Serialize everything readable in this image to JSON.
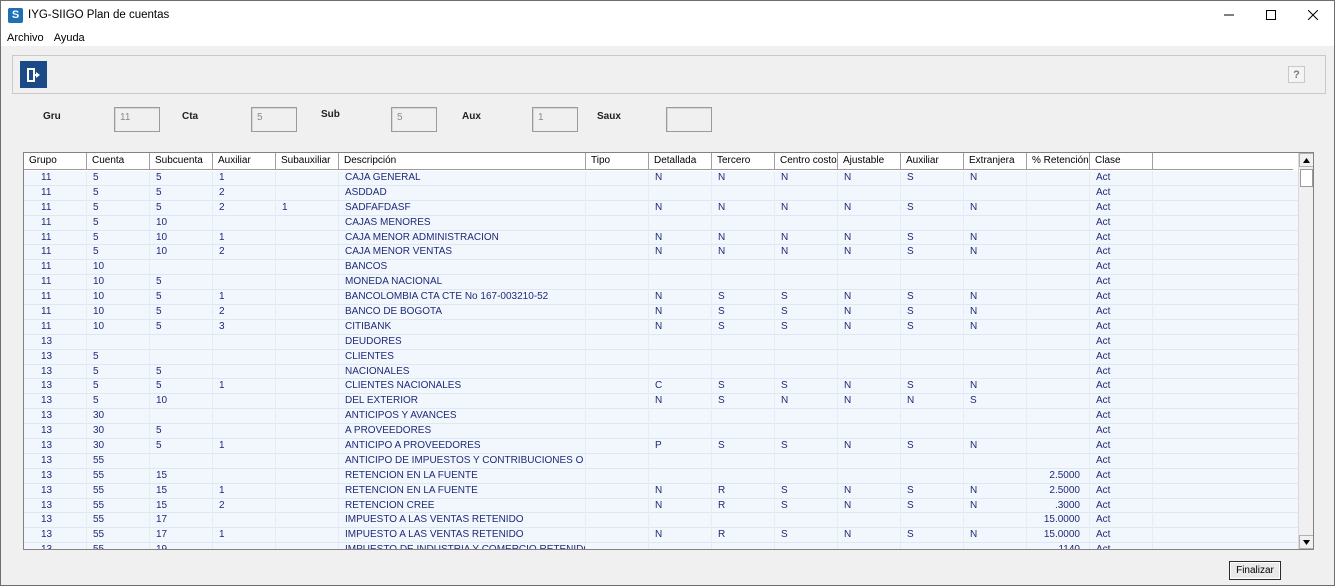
{
  "window": {
    "title": "IYG-SIIGO Plan de cuentas",
    "app_icon_letter": "S"
  },
  "menu": [
    "Archivo",
    "Ayuda"
  ],
  "toolbar": {
    "help_label": "?"
  },
  "filters": {
    "gru": {
      "label": "Gru",
      "value": "11"
    },
    "cta": {
      "label": "Cta",
      "value": "5"
    },
    "sub": {
      "label": "Sub",
      "value": "5"
    },
    "aux": {
      "label": "Aux",
      "value": "1"
    },
    "saux": {
      "label": "Saux",
      "value": ""
    }
  },
  "grid": {
    "columns": [
      "Grupo",
      "Cuenta",
      "Subcuenta",
      "Auxiliar",
      "Subauxiliar",
      "Descripción",
      "Tipo",
      "Detallada",
      "Tercero",
      "Centro costo",
      "Ajustable",
      "Auxiliar",
      "Extranjera",
      "% Retención",
      "Clase"
    ],
    "rows": [
      [
        "11",
        "5",
        "5",
        "1",
        "",
        "CAJA GENERAL",
        "",
        "N",
        "N",
        "N",
        "N",
        "S",
        "N",
        "",
        "Act"
      ],
      [
        "11",
        "5",
        "5",
        "2",
        "",
        "ASDDAD",
        "",
        "",
        "",
        "",
        "",
        "",
        "",
        "",
        "Act"
      ],
      [
        "11",
        "5",
        "5",
        "2",
        "1",
        "SADFAFDASF",
        "",
        "N",
        "N",
        "N",
        "N",
        "S",
        "N",
        "",
        "Act"
      ],
      [
        "11",
        "5",
        "10",
        "",
        "",
        "CAJAS MENORES",
        "",
        "",
        "",
        "",
        "",
        "",
        "",
        "",
        "Act"
      ],
      [
        "11",
        "5",
        "10",
        "1",
        "",
        "CAJA MENOR ADMINISTRACION",
        "",
        "N",
        "N",
        "N",
        "N",
        "S",
        "N",
        "",
        "Act"
      ],
      [
        "11",
        "5",
        "10",
        "2",
        "",
        "CAJA MENOR VENTAS",
        "",
        "N",
        "N",
        "N",
        "N",
        "S",
        "N",
        "",
        "Act"
      ],
      [
        "11",
        "10",
        "",
        "",
        "",
        "BANCOS",
        "",
        "",
        "",
        "",
        "",
        "",
        "",
        "",
        "Act"
      ],
      [
        "11",
        "10",
        "5",
        "",
        "",
        "MONEDA NACIONAL",
        "",
        "",
        "",
        "",
        "",
        "",
        "",
        "",
        "Act"
      ],
      [
        "11",
        "10",
        "5",
        "1",
        "",
        "BANCOLOMBIA CTA CTE No 167-003210-52",
        "",
        "N",
        "S",
        "S",
        "N",
        "S",
        "N",
        "",
        "Act"
      ],
      [
        "11",
        "10",
        "5",
        "2",
        "",
        "BANCO DE BOGOTA",
        "",
        "N",
        "S",
        "S",
        "N",
        "S",
        "N",
        "",
        "Act"
      ],
      [
        "11",
        "10",
        "5",
        "3",
        "",
        "CITIBANK",
        "",
        "N",
        "S",
        "S",
        "N",
        "S",
        "N",
        "",
        "Act"
      ],
      [
        "13",
        "",
        "",
        "",
        "",
        "DEUDORES",
        "",
        "",
        "",
        "",
        "",
        "",
        "",
        "",
        "Act"
      ],
      [
        "13",
        "5",
        "",
        "",
        "",
        "CLIENTES",
        "",
        "",
        "",
        "",
        "",
        "",
        "",
        "",
        "Act"
      ],
      [
        "13",
        "5",
        "5",
        "",
        "",
        "NACIONALES",
        "",
        "",
        "",
        "",
        "",
        "",
        "",
        "",
        "Act"
      ],
      [
        "13",
        "5",
        "5",
        "1",
        "",
        "CLIENTES NACIONALES",
        "",
        "C",
        "S",
        "S",
        "N",
        "S",
        "N",
        "",
        "Act"
      ],
      [
        "13",
        "5",
        "10",
        "",
        "",
        "DEL EXTERIOR",
        "",
        "N",
        "S",
        "N",
        "N",
        "N",
        "S",
        "",
        "Act"
      ],
      [
        "13",
        "30",
        "",
        "",
        "",
        "ANTICIPOS Y AVANCES",
        "",
        "",
        "",
        "",
        "",
        "",
        "",
        "",
        "Act"
      ],
      [
        "13",
        "30",
        "5",
        "",
        "",
        "A PROVEEDORES",
        "",
        "",
        "",
        "",
        "",
        "",
        "",
        "",
        "Act"
      ],
      [
        "13",
        "30",
        "5",
        "1",
        "",
        "ANTICIPO A PROVEEDORES",
        "",
        "P",
        "S",
        "S",
        "N",
        "S",
        "N",
        "",
        "Act"
      ],
      [
        "13",
        "55",
        "",
        "",
        "",
        "ANTICIPO DE IMPUESTOS Y CONTRIBUCIONES O ...",
        "",
        "",
        "",
        "",
        "",
        "",
        "",
        "",
        "Act"
      ],
      [
        "13",
        "55",
        "15",
        "",
        "",
        "RETENCION EN LA FUENTE",
        "",
        "",
        "",
        "",
        "",
        "",
        "",
        "2.5000",
        "Act"
      ],
      [
        "13",
        "55",
        "15",
        "1",
        "",
        "RETENCION EN LA FUENTE",
        "",
        "N",
        "R",
        "S",
        "N",
        "S",
        "N",
        "2.5000",
        "Act"
      ],
      [
        "13",
        "55",
        "15",
        "2",
        "",
        "RETENCION CREE",
        "",
        "N",
        "R",
        "S",
        "N",
        "S",
        "N",
        ".3000",
        "Act"
      ],
      [
        "13",
        "55",
        "17",
        "",
        "",
        "IMPUESTO A LAS VENTAS RETENIDO",
        "",
        "",
        "",
        "",
        "",
        "",
        "",
        "15.0000",
        "Act"
      ],
      [
        "13",
        "55",
        "17",
        "1",
        "",
        "IMPUESTO A LAS VENTAS RETENIDO",
        "",
        "N",
        "R",
        "S",
        "N",
        "S",
        "N",
        "15.0000",
        "Act"
      ],
      [
        "13",
        "55",
        "19",
        "",
        "",
        "IMPUESTO DE INDUSTRIA Y COMERCIO RETENIDO",
        "",
        "",
        "",
        "",
        "",
        "",
        "",
        ".1140",
        "Act"
      ]
    ]
  },
  "footer": {
    "finish_label": "Finalizar"
  },
  "colors": {
    "cell_text": "#1e2a78",
    "row_bg": "#f2f7fd",
    "exit_button": "#1b4a86"
  }
}
